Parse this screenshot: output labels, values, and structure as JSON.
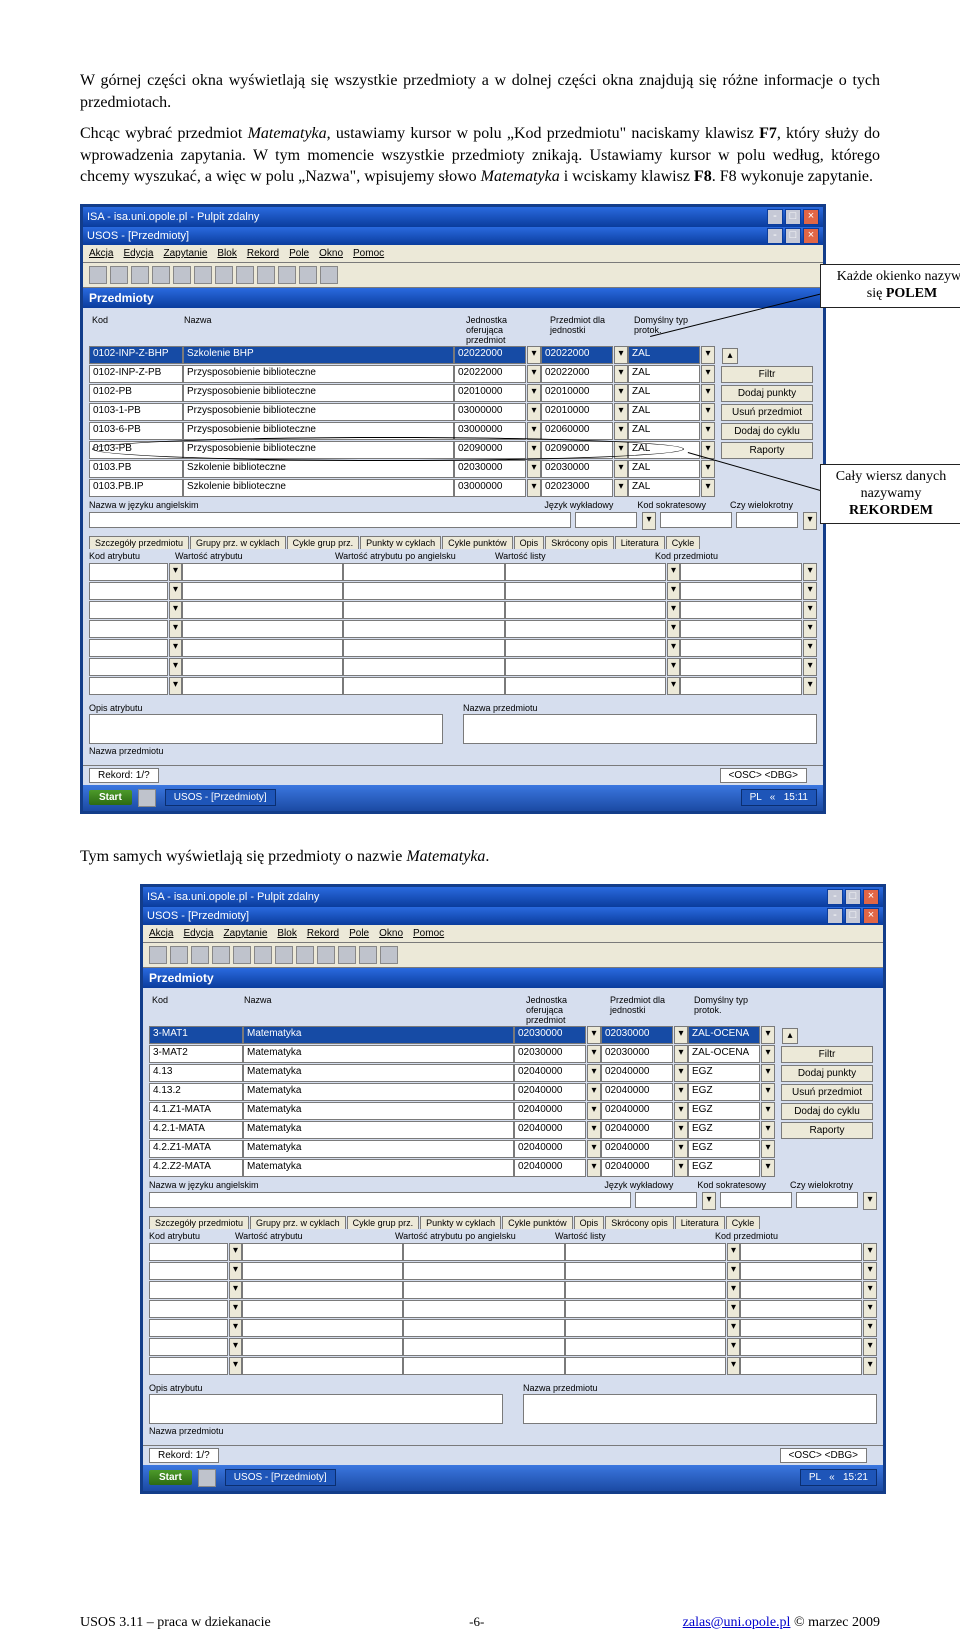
{
  "para1": "W górnej części okna wyświetlają się wszystkie przedmioty a w dolnej części okna znajdują się różne informacje o tych przedmiotach.",
  "para2_a": "Chcąc wybrać przedmiot ",
  "para2_i1": "Matematyka",
  "para2_b": ", ustawiamy kursor w polu „Kod przedmiotu\" naciskamy klawisz ",
  "para2_bold1": "F7",
  "para2_c": ", który służy do wprowadzenia zapytania. W tym momencie wszystkie przedmioty znikają. Ustawiamy kursor w polu według, którego chcemy wyszukać, a więc w polu „Nazwa\", wpisujemy słowo ",
  "para2_i2": "Matematyka",
  "para2_d": " i wciskamy klawisz ",
  "para2_bold2": "F8",
  "para2_e": ". F8 wykonuje zapytanie.",
  "callout1_l1": "Każde okienko nazywa",
  "callout1_l2a": "się ",
  "callout1_l2b": "POLEM",
  "callout2_l1": "Cały wiersz danych",
  "callout2_l2": "nazywamy",
  "callout2_l3": "REKORDEM",
  "para3_a": "Tym samych wyświetlają się przedmioty o nazwie ",
  "para3_i1": "Matematyka",
  "para3_b": ".",
  "window": {
    "title_outer": "ISA - isa.uni.opole.pl - Pulpit zdalny",
    "title_inner": "USOS - [Przedmioty]",
    "menu": [
      "Akcja",
      "Edycja",
      "Zapytanie",
      "Blok",
      "Rekord",
      "Pole",
      "Okno",
      "Pomoc"
    ],
    "heading": "Przedmioty",
    "cols": {
      "kod": "Kod",
      "nazwa": "Nazwa",
      "jedn": "Jednostka oferująca przedmiot",
      "prz": "Przedmiot dla jednostki",
      "dom": "Domyślny typ protok."
    },
    "buttons": [
      "Filtr",
      "Dodaj punkty",
      "Usuń przedmiot",
      "Dodaj do cyklu",
      "Raporty"
    ],
    "mid": {
      "nazwa_ang": "Nazwa w języku angielskim",
      "jezyk": "Język wykładowy",
      "kod_sok": "Kod sokratesowy",
      "wiel": "Czy wielokrotny"
    },
    "tabs": [
      "Szczegóły przedmiotu",
      "Grupy prz. w cyklach",
      "Cykle grup prz.",
      "Punkty w cyklach",
      "Cykle punktów",
      "Opis",
      "Skrócony opis",
      "Literatura",
      "Cykle"
    ],
    "lowcols": [
      "Kod atrybutu",
      "Wartość atrybutu",
      "Wartość atrybutu po angielsku",
      "Wartość listy",
      "Kod przedmiotu"
    ],
    "opis_atr": "Opis atrybutu",
    "nazwa_prz": "Nazwa przedmiotu",
    "rekord": "Rekord: 1/?",
    "osc": "<OSC> <DBG>",
    "start": "Start",
    "task_app": "USOS - [Przedmioty]",
    "lang": "PL"
  },
  "shot1": {
    "rows": [
      {
        "kod": "0102-INP-Z-BHP",
        "nazwa": "Szkolenie BHP",
        "j": "02022000",
        "p": "02022000",
        "d": "ZAL",
        "sel": true
      },
      {
        "kod": "0102-INP-Z-PB",
        "nazwa": "Przysposobienie biblioteczne",
        "j": "02022000",
        "p": "02022000",
        "d": "ZAL"
      },
      {
        "kod": "0102-PB",
        "nazwa": "Przysposobienie biblioteczne",
        "j": "02010000",
        "p": "02010000",
        "d": "ZAL"
      },
      {
        "kod": "0103-1-PB",
        "nazwa": "Przysposobienie biblioteczne",
        "j": "03000000",
        "p": "02010000",
        "d": "ZAL"
      },
      {
        "kod": "0103-6-PB",
        "nazwa": "Przysposobienie biblioteczne",
        "j": "03000000",
        "p": "02060000",
        "d": "ZAL"
      },
      {
        "kod": "0103-PB",
        "nazwa": "Przysposobienie biblioteczne",
        "j": "02090000",
        "p": "02090000",
        "d": "ZAL"
      },
      {
        "kod": "0103.PB",
        "nazwa": "Szkolenie biblioteczne",
        "j": "02030000",
        "p": "02030000",
        "d": "ZAL"
      },
      {
        "kod": "0103.PB.IP",
        "nazwa": "Szkolenie biblioteczne",
        "j": "03000000",
        "p": "02023000",
        "d": "ZAL"
      }
    ],
    "time": "15:11"
  },
  "shot2": {
    "rows": [
      {
        "kod": "3-MAT1",
        "nazwa": "Matematyka",
        "j": "02030000",
        "p": "02030000",
        "d": "ZAL-OCENA",
        "sel": true
      },
      {
        "kod": "3-MAT2",
        "nazwa": "Matematyka",
        "j": "02030000",
        "p": "02030000",
        "d": "ZAL-OCENA"
      },
      {
        "kod": "4.13",
        "nazwa": "Matematyka",
        "j": "02040000",
        "p": "02040000",
        "d": "EGZ"
      },
      {
        "kod": "4.13.2",
        "nazwa": "Matematyka",
        "j": "02040000",
        "p": "02040000",
        "d": "EGZ"
      },
      {
        "kod": "4.1.Z1-MATA",
        "nazwa": "Matematyka",
        "j": "02040000",
        "p": "02040000",
        "d": "EGZ"
      },
      {
        "kod": "4.2.1-MATA",
        "nazwa": "Matematyka",
        "j": "02040000",
        "p": "02040000",
        "d": "EGZ"
      },
      {
        "kod": "4.2.Z1-MATA",
        "nazwa": "Matematyka",
        "j": "02040000",
        "p": "02040000",
        "d": "EGZ"
      },
      {
        "kod": "4.2.Z2-MATA",
        "nazwa": "Matematyka",
        "j": "02040000",
        "p": "02040000",
        "d": "EGZ"
      }
    ],
    "time": "15:21"
  },
  "footer": {
    "left": "USOS 3.11 – praca w dziekanacie",
    "mid": "-6-",
    "email": "zalas@uni.opole.pl",
    "right": " © marzec 2009"
  }
}
